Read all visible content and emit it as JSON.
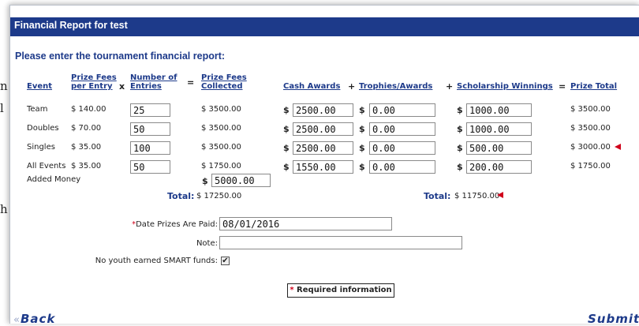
{
  "background_fragments": [
    "n",
    "l",
    "h"
  ],
  "dialog": {
    "title": "Financial Report for test",
    "prompt": "Please enter the tournament financial report:"
  },
  "columns": {
    "event": "Event",
    "prize_fees_per_entry_1": "Prize Fees",
    "prize_fees_per_entry_2": "per Entry",
    "number_of_entries_1": "Number of",
    "number_of_entries_2": "Entries",
    "prize_fees_collected_1": "Prize Fees",
    "prize_fees_collected_2": "Collected",
    "cash_awards": "Cash Awards",
    "trophies_awards": "Trophies/Awards",
    "scholarship_winnings": "Scholarship Winnings",
    "prize_total": "Prize Total",
    "op_times": "x",
    "op_equals": "=",
    "op_plus": "+"
  },
  "currency_symbol": "$",
  "rows": [
    {
      "event": "Team",
      "fee": "$ 140.00",
      "entries": "25",
      "collected": "$ 3500.00",
      "cash": "2500.00",
      "trophies": "0.00",
      "scholarship": "1000.00",
      "total": "$ 3500.00",
      "flag": false
    },
    {
      "event": "Doubles",
      "fee": "$ 70.00",
      "entries": "50",
      "collected": "$ 3500.00",
      "cash": "2500.00",
      "trophies": "0.00",
      "scholarship": "1000.00",
      "total": "$ 3500.00",
      "flag": false
    },
    {
      "event": "Singles",
      "fee": "$ 35.00",
      "entries": "100",
      "collected": "$ 3500.00",
      "cash": "2500.00",
      "trophies": "0.00",
      "scholarship": "500.00",
      "total": "$ 3000.00",
      "flag": true
    },
    {
      "event": "All Events",
      "fee": "$ 35.00",
      "entries": "50",
      "collected": "$ 1750.00",
      "cash": "1550.00",
      "trophies": "0.00",
      "scholarship": "200.00",
      "total": "$ 1750.00",
      "flag": false
    }
  ],
  "added_money": {
    "label": "Added Money",
    "value": "5000.00"
  },
  "totals": {
    "label": "Total:",
    "collected": "$ 17250.00",
    "prize": "$ 11750.00"
  },
  "form": {
    "date_label_star": "*",
    "date_label": "Date Prizes Are Paid:",
    "date_value": "08/01/2016",
    "note_label": "Note:",
    "note_value": "",
    "youth_label": "No youth earned SMART funds:",
    "youth_checked": true
  },
  "required_info": {
    "star": "*",
    "text": "Required information"
  },
  "nav": {
    "back": "Back",
    "submit": "Submit",
    "back_arrow": "«",
    "submit_arrow": "»"
  },
  "colors": {
    "title_bar": "#1d3a8a",
    "heading": "#1d3a8a",
    "flag": "#d0021b"
  }
}
